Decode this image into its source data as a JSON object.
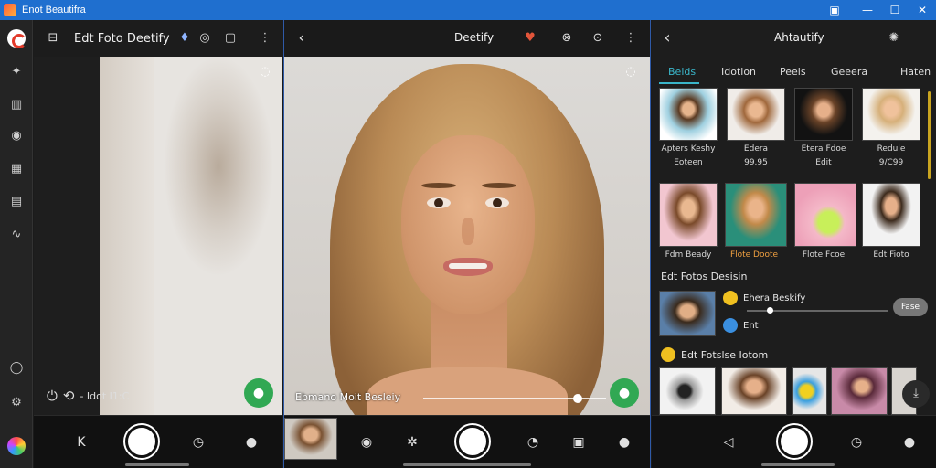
{
  "window": {
    "title": "Enot Beautifra",
    "controls": {
      "pip": "▣",
      "minimize": "—",
      "maximize": "☐",
      "close": "✕"
    }
  },
  "rail": {
    "icons": [
      "logo-icon",
      "sparkle-icon",
      "book-icon",
      "circle-icon",
      "calendar-icon",
      "gallery-icon",
      "wand-icon",
      "chat-icon",
      "settings-icon",
      "flower-icon"
    ],
    "glyphs": {
      "sparkle": "✦",
      "book": "▥",
      "circle": "◉",
      "calendar": "▦",
      "gallery": "▤",
      "wand": "∿",
      "chat": "◯",
      "settings": "⚙"
    }
  },
  "pane1": {
    "title": "Edt Foto Deetify",
    "timer_text": "- Idot I1:C",
    "glyphs": {
      "edit": "⊟",
      "gem": "♦",
      "rotate": "◎",
      "crop": "▢",
      "more": "⋮",
      "power": "⏻",
      "timer": "⟲",
      "focus": "◌",
      "chat": "●",
      "arrow": "K",
      "clock": "◷",
      "person": "●"
    }
  },
  "pane2": {
    "title": "Deetify",
    "slider_label": "Ebmano   Moit Besleiy",
    "glyphs": {
      "back": "‹",
      "rose": "♥",
      "filter": "⊗",
      "compass": "⊙",
      "more": "⋮",
      "focus": "◌",
      "chat": "●",
      "record": "◉",
      "sticker": "✲",
      "timer": "◔",
      "gallery": "▣",
      "person": "●"
    }
  },
  "pane3": {
    "title": "Ahtautify",
    "tabs": [
      "Beids",
      "Idotion",
      "Peeis",
      "Geeera",
      "Haten"
    ],
    "grid_row1": [
      {
        "caption": "Apters Keshy",
        "sub": "Eoteen"
      },
      {
        "caption": "Edera",
        "sub": "99.95"
      },
      {
        "caption": "Etera Fdoe",
        "sub": "Edit"
      },
      {
        "caption": "Redule",
        "sub": "9/C99"
      }
    ],
    "grid_row2": [
      {
        "caption": "Fdm Beady"
      },
      {
        "caption": "Flote Doote"
      },
      {
        "caption": "Flote Fcoe"
      },
      {
        "caption": "Edt Fioto"
      }
    ],
    "section_title_1": "Edt Fotos Desisin",
    "row_card": {
      "line1": "Ehera Beskify",
      "line2": "Ent",
      "pill": "Fase"
    },
    "section_title_2": "Edt Fotslse Iotom",
    "glyphs": {
      "back": "‹",
      "globe": "✺",
      "download": "⤓",
      "back_nav": "◁",
      "clock": "◷",
      "person": "●"
    }
  },
  "colors": {
    "title_bar": "#1f6fcf",
    "accent_teal": "#3ab5c9",
    "accent_green": "#31a853",
    "caption_orange": "#f0a040",
    "scroll_gold": "#c9a520"
  }
}
